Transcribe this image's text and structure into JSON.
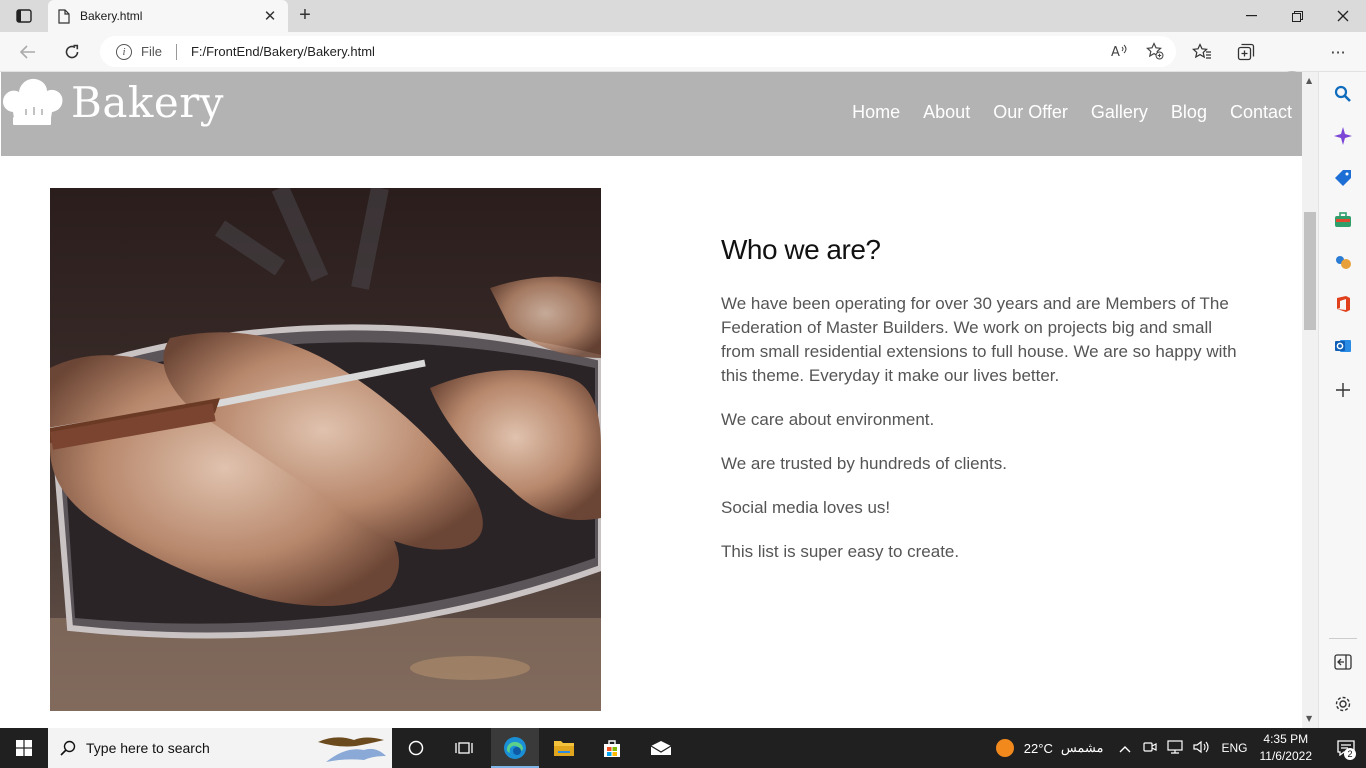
{
  "browser": {
    "tab_title": "Bakery.html",
    "tab_close": "✕",
    "new_tab": "+",
    "window_controls": {
      "minimize": "—",
      "restore": "❐",
      "close": "✕"
    },
    "address": {
      "scheme": "File",
      "url": "F:/FrontEnd/Bakery/Bakery.html"
    },
    "more": "···"
  },
  "site": {
    "logo_text": "Bakery",
    "nav": [
      "Home",
      "About",
      "Our Offer",
      "Gallery",
      "Blog",
      "Contact"
    ],
    "about": {
      "heading": "Who we are?",
      "paragraphs": [
        "We have been operating for over 30 years and are Members of The Federation of Master Builders. We work on projects big and small from small residential extensions to full house. We are so happy with this theme. Everyday it make our lives better.",
        "We care about environment.",
        "We are trusted by hundreds of clients.",
        "Social media loves us!",
        "This list is super easy to create."
      ]
    }
  },
  "taskbar": {
    "search_placeholder": "Type here to search",
    "weather": {
      "temp": "22°C",
      "condition": "مشمس"
    },
    "language": "ENG",
    "time": "4:35 PM",
    "date": "11/6/2022",
    "notifications": "2"
  },
  "colors": {
    "header_bg": "#b3b3b3",
    "taskbar_bg": "#202020",
    "text_muted": "#555555",
    "accent_blue": "#0078d4"
  }
}
